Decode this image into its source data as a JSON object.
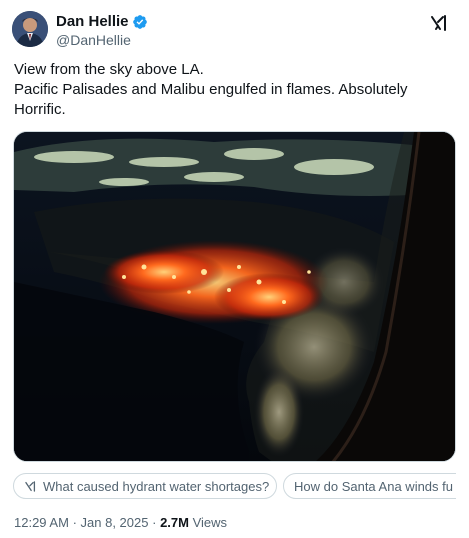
{
  "author": {
    "name": "Dan Hellie",
    "handle": "@DanHellie",
    "verified": true
  },
  "tweet": {
    "lines": [
      "View from the sky above LA.",
      "Pacific Palisades and Malibu engulfed in flames.  Absolutely",
      "Horrific."
    ]
  },
  "suggestions": [
    "What caused hydrant water shortages?",
    "How do Santa Ana winds fu"
  ],
  "meta": {
    "time": "12:29 AM",
    "date": "Jan 8, 2025",
    "separator": "·",
    "views_count": "2.7M",
    "views_label": "Views"
  },
  "colors": {
    "verified_badge": "#1d9bf0",
    "secondary_text": "#536471",
    "primary_text": "#0f1419",
    "fire": "#ff5a1a"
  },
  "icons": {
    "verified": "verified-badge-icon",
    "header_action": "grok-icon",
    "suggestion": "grok-icon"
  }
}
